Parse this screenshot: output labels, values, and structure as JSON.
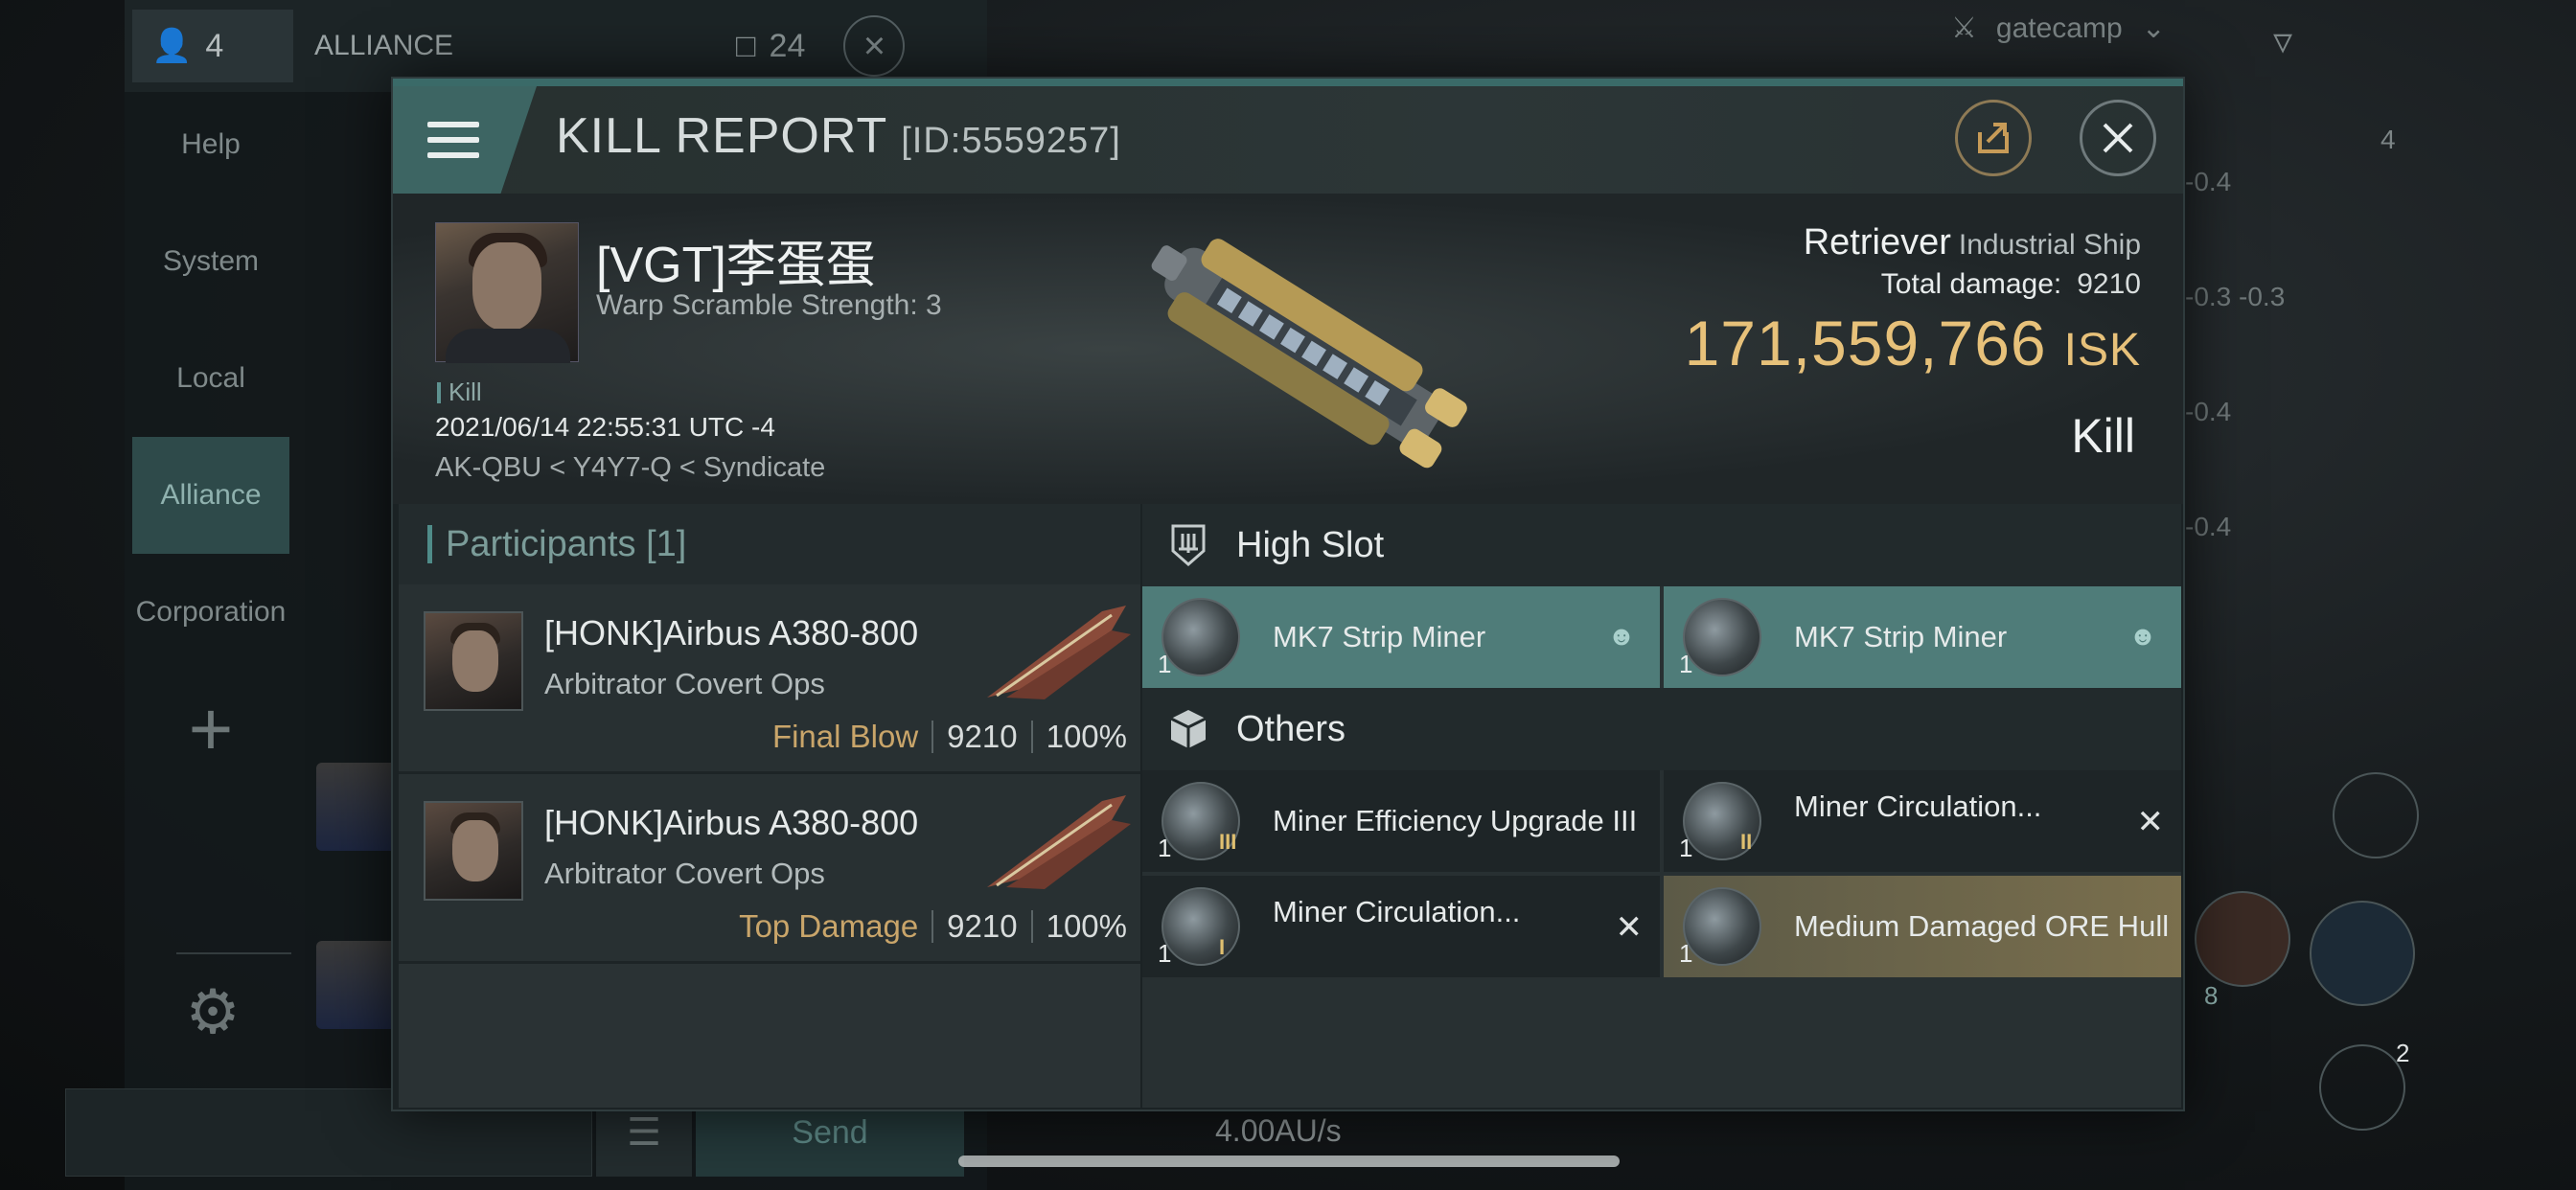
{
  "background": {
    "member_count": "4",
    "channel_title": "ALLIANCE",
    "chat_count": "24",
    "nav_items": [
      "Help",
      "System",
      "Local",
      "Alliance",
      "Corporation"
    ],
    "send_label": "Send",
    "speed": "4.00AU/s",
    "filter_label": "gatecamp",
    "hud_values": [
      "-0.4",
      "-0.3 -0.3",
      "-0.4",
      "-0.4"
    ],
    "hud_badge": "4",
    "slot_badge_8": "8",
    "slot_badge_2": "2"
  },
  "kill_report": {
    "title": "KILL REPORT",
    "id": "[ID:5559257]",
    "victim": {
      "name": "[VGT]李蛋蛋",
      "warp_scramble": "Warp Scramble Strength: 3",
      "tag": "Kill",
      "date": "2021/06/14 22:55:31 UTC -4",
      "location": "AK-QBU < Y4Y7-Q < Syndicate"
    },
    "ship": {
      "name": "Retriever",
      "class": "Industrial Ship",
      "total_damage_label": "Total damage:",
      "total_damage": "9210",
      "isk_value": "171,559,766",
      "isk_unit": "ISK",
      "result": "Kill"
    },
    "participants": {
      "header": "Participants [1]",
      "rows": [
        {
          "name": "[HONK]Airbus A380-800",
          "ship": "Arbitrator Covert Ops",
          "role": "Final Blow",
          "damage": "9210",
          "percent": "100%"
        },
        {
          "name": "[HONK]Airbus A380-800",
          "ship": "Arbitrator Covert Ops",
          "role": "Top Damage",
          "damage": "9210",
          "percent": "100%"
        }
      ]
    },
    "high_slot": {
      "header": "High Slot",
      "items": [
        {
          "qty": "1",
          "name": "MK7 Strip Miner"
        },
        {
          "qty": "1",
          "name": "MK7 Strip Miner"
        }
      ]
    },
    "others": {
      "header": "Others",
      "items": [
        {
          "qty": "1",
          "name": "Miner Efficiency Upgrade III",
          "tier": "III"
        },
        {
          "qty": "1",
          "name": "Miner Circulation...",
          "tier": "II"
        },
        {
          "qty": "1",
          "name": "Miner Circulation...",
          "tier": "I"
        },
        {
          "qty": "1",
          "name": "Medium Damaged ORE Hull"
        }
      ]
    }
  }
}
